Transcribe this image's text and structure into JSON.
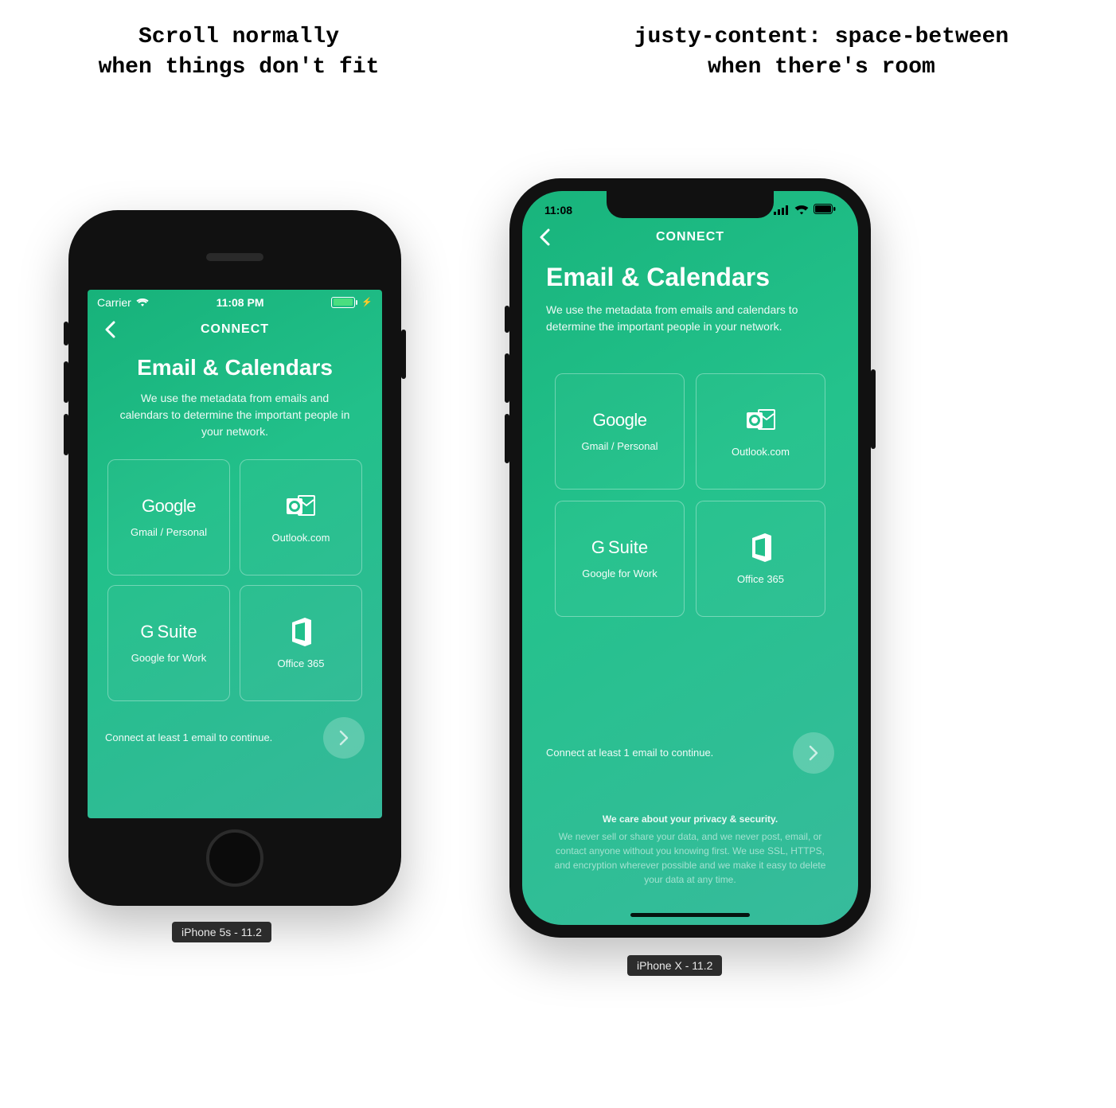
{
  "captions": {
    "left_l1": "Scroll normally",
    "left_l2": "when things don't fit",
    "right_l1": "justy-content: space-between",
    "right_l2": "when there's room"
  },
  "device_labels": {
    "iphone5": "iPhone 5s - 11.2",
    "iphonex": "iPhone X - 11.2"
  },
  "status": {
    "iphone5": {
      "carrier": "Carrier",
      "time": "11:08 PM"
    },
    "iphonex": {
      "time": "11:08"
    }
  },
  "nav": {
    "title": "CONNECT"
  },
  "page": {
    "heading": "Email & Calendars",
    "sub5": "We use the metadata from emails and calendars to determine the important people in your network.",
    "subx": "We use the metadata from emails and calendars to determine the important people in your network."
  },
  "tiles": {
    "google": {
      "brand": "Google",
      "label": "Gmail / Personal"
    },
    "outlook": {
      "brand": "Outlook",
      "label": "Outlook.com"
    },
    "gsuite": {
      "brand": "G Suite",
      "label": "Google for Work"
    },
    "o365": {
      "brand": "Office",
      "label": "Office 365"
    }
  },
  "footer": {
    "hint": "Connect at least 1 email to continue."
  },
  "privacy": {
    "title": "We care about your privacy & security.",
    "body": "We never sell or share your data, and we never post, email, or contact anyone without you knowing first. We use SSL, HTTPS, and encryption wherever possible and we make it easy to delete your data at any time."
  }
}
